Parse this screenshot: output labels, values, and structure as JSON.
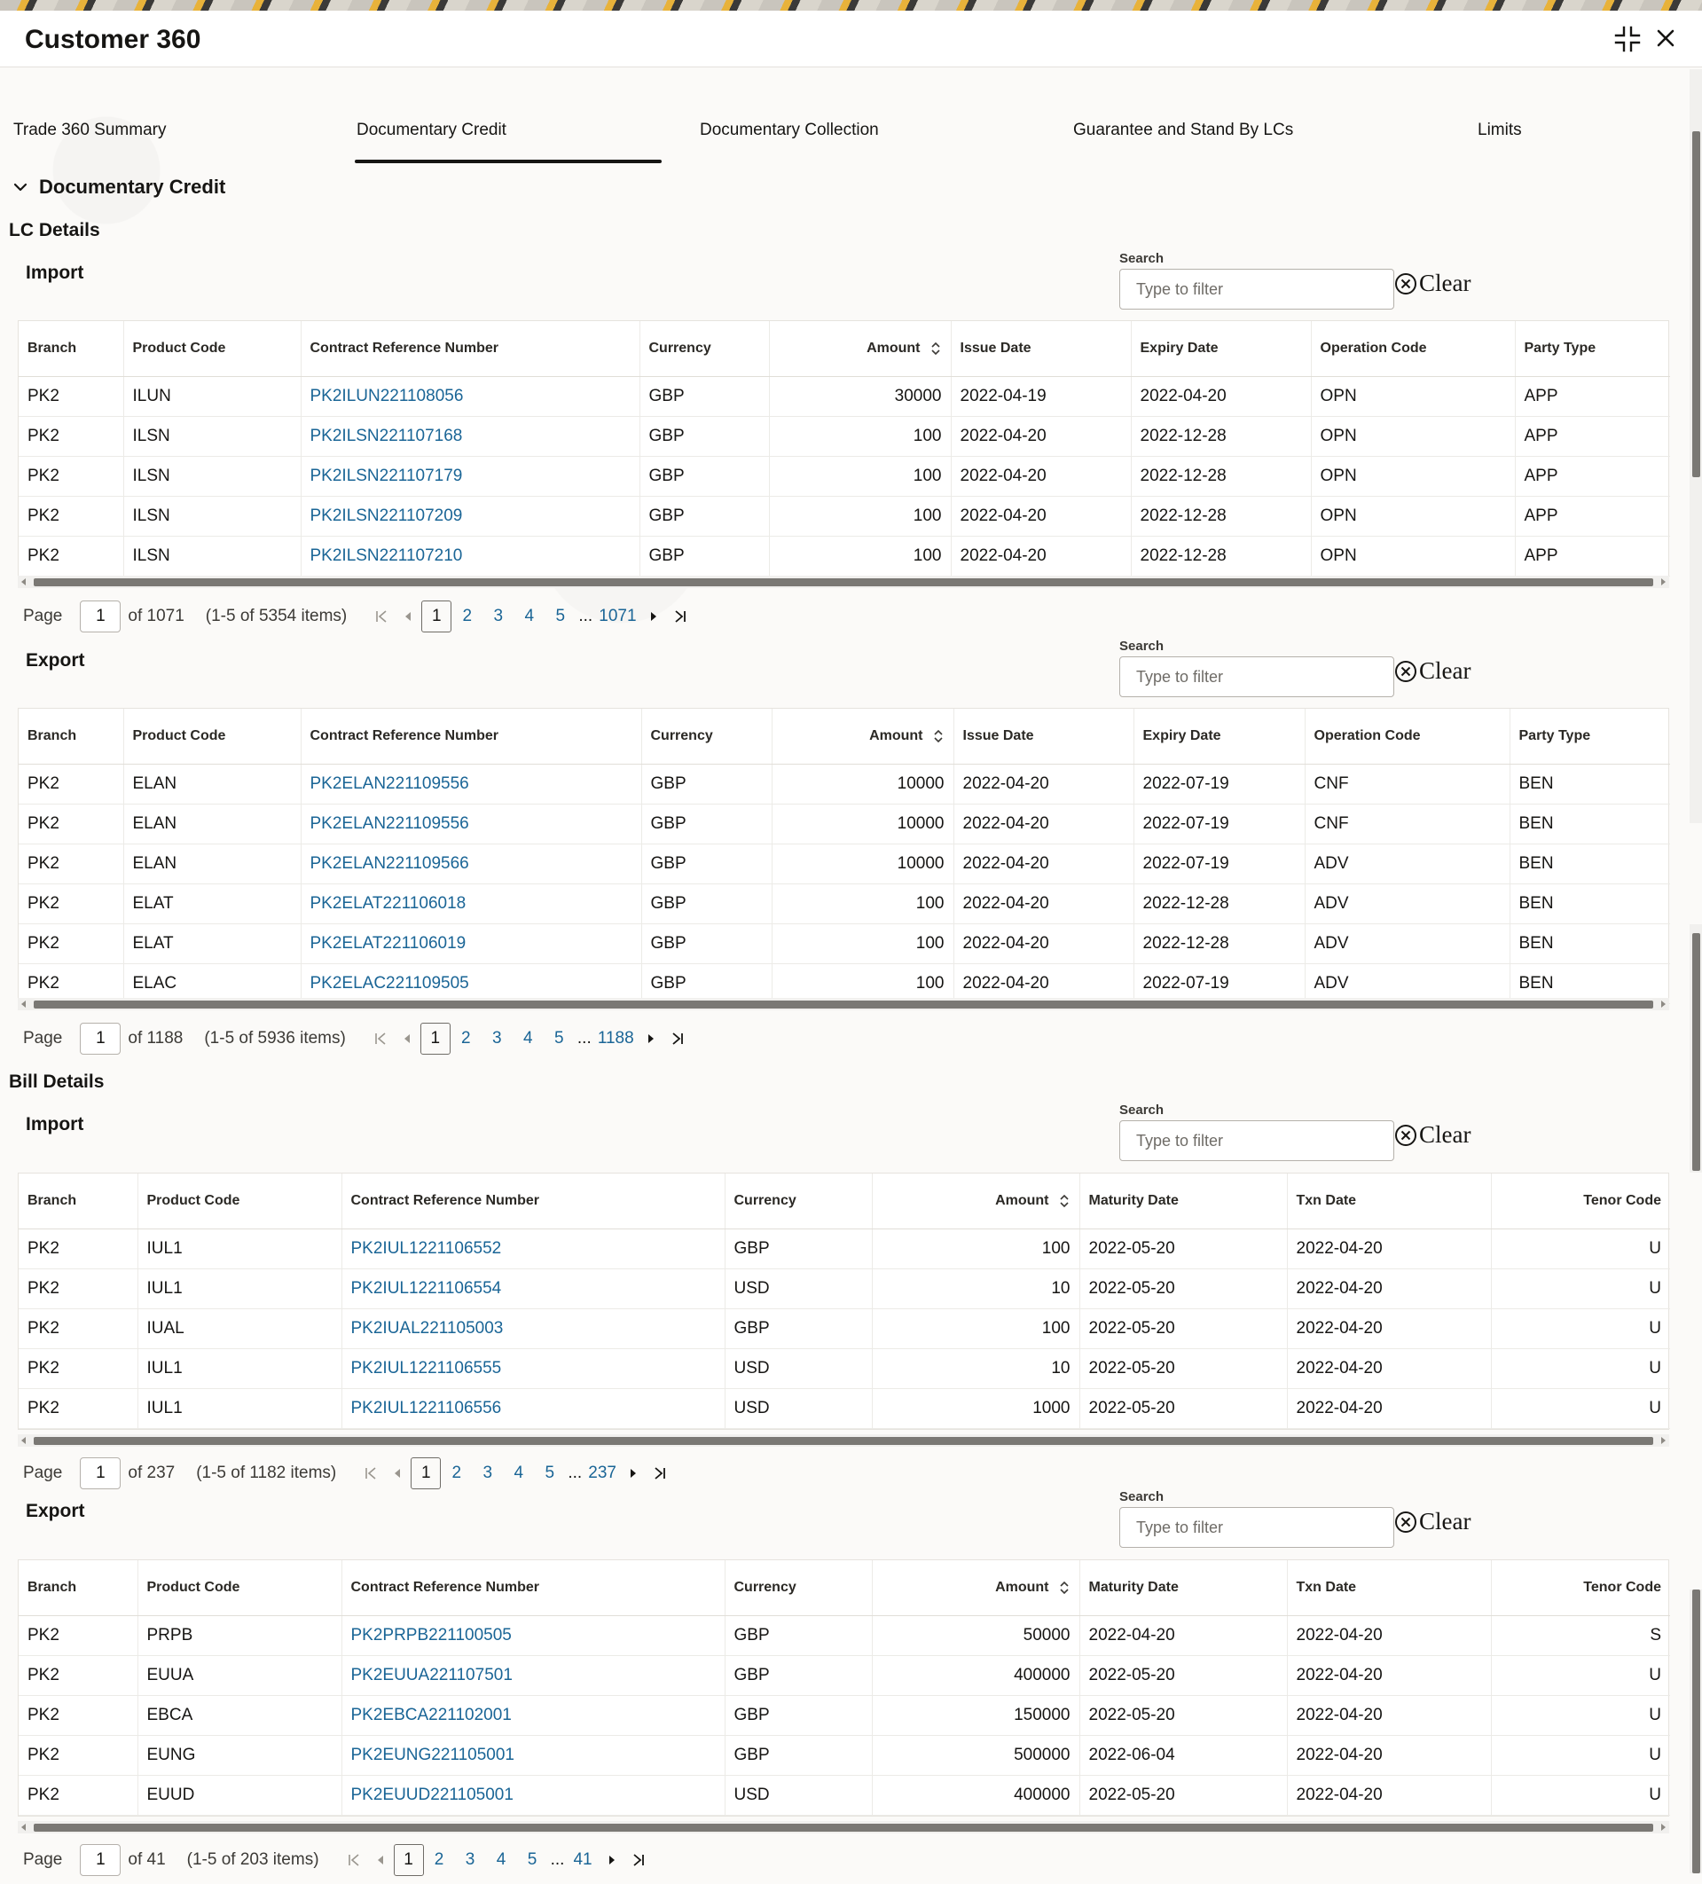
{
  "window": {
    "title": "Customer 360"
  },
  "tabs": [
    {
      "label": "Trade 360 Summary"
    },
    {
      "label": "Documentary Credit"
    },
    {
      "label": "Documentary Collection"
    },
    {
      "label": "Guarantee and Stand By LCs"
    },
    {
      "label": "Limits"
    }
  ],
  "active_tab": "Documentary Credit",
  "section": {
    "title": "Documentary Credit"
  },
  "lc_details": {
    "title": "LC Details"
  },
  "bill_details": {
    "title": "Bill Details"
  },
  "search": {
    "label": "Search",
    "placeholder": "Type to filter",
    "clear_label": "Clear"
  },
  "pager_labels": {
    "page": "Page",
    "ellipsis": "..."
  },
  "lc_import": {
    "title": "Import",
    "columns": [
      "Branch",
      "Product Code",
      "Contract Reference Number",
      "Currency",
      "Amount",
      "Issue Date",
      "Expiry Date",
      "Operation Code",
      "Party Type"
    ],
    "rows": [
      [
        "PK2",
        "ILUN",
        "PK2ILUN221108056",
        "GBP",
        "30000",
        "2022-04-19",
        "2022-04-20",
        "OPN",
        "APP"
      ],
      [
        "PK2",
        "ILSN",
        "PK2ILSN221107168",
        "GBP",
        "100",
        "2022-04-20",
        "2022-12-28",
        "OPN",
        "APP"
      ],
      [
        "PK2",
        "ILSN",
        "PK2ILSN221107179",
        "GBP",
        "100",
        "2022-04-20",
        "2022-12-28",
        "OPN",
        "APP"
      ],
      [
        "PK2",
        "ILSN",
        "PK2ILSN221107209",
        "GBP",
        "100",
        "2022-04-20",
        "2022-12-28",
        "OPN",
        "APP"
      ],
      [
        "PK2",
        "ILSN",
        "PK2ILSN221107210",
        "GBP",
        "100",
        "2022-04-20",
        "2022-12-28",
        "OPN",
        "APP"
      ]
    ],
    "pager": {
      "current": "1",
      "of_text": "of 1071",
      "summary": "(1-5 of 5354 items)",
      "pages": [
        "2",
        "3",
        "4",
        "5"
      ],
      "last": "1071"
    }
  },
  "lc_export": {
    "title": "Export",
    "columns": [
      "Branch",
      "Product Code",
      "Contract Reference Number",
      "Currency",
      "Amount",
      "Issue Date",
      "Expiry Date",
      "Operation Code",
      "Party Type"
    ],
    "rows": [
      [
        "PK2",
        "ELAN",
        "PK2ELAN221109556",
        "GBP",
        "10000",
        "2022-04-20",
        "2022-07-19",
        "CNF",
        "BEN"
      ],
      [
        "PK2",
        "ELAN",
        "PK2ELAN221109556",
        "GBP",
        "10000",
        "2022-04-20",
        "2022-07-19",
        "CNF",
        "BEN"
      ],
      [
        "PK2",
        "ELAN",
        "PK2ELAN221109566",
        "GBP",
        "10000",
        "2022-04-20",
        "2022-07-19",
        "ADV",
        "BEN"
      ],
      [
        "PK2",
        "ELAT",
        "PK2ELAT221106018",
        "GBP",
        "100",
        "2022-04-20",
        "2022-12-28",
        "ADV",
        "BEN"
      ],
      [
        "PK2",
        "ELAT",
        "PK2ELAT221106019",
        "GBP",
        "100",
        "2022-04-20",
        "2022-12-28",
        "ADV",
        "BEN"
      ],
      [
        "PK2",
        "ELAC",
        "PK2ELAC221109505",
        "GBP",
        "100",
        "2022-04-20",
        "2022-07-19",
        "ADV",
        "BEN"
      ]
    ],
    "pager": {
      "current": "1",
      "of_text": "of 1188",
      "summary": "(1-5 of 5936 items)",
      "pages": [
        "2",
        "3",
        "4",
        "5"
      ],
      "last": "1188"
    }
  },
  "bill_import": {
    "title": "Import",
    "columns": [
      "Branch",
      "Product Code",
      "Contract Reference Number",
      "Currency",
      "Amount",
      "Maturity Date",
      "Txn Date",
      "Tenor Code"
    ],
    "rows": [
      [
        "PK2",
        "IUL1",
        "PK2IUL1221106552",
        "GBP",
        "100",
        "2022-05-20",
        "2022-04-20",
        "U"
      ],
      [
        "PK2",
        "IUL1",
        "PK2IUL1221106554",
        "USD",
        "10",
        "2022-05-20",
        "2022-04-20",
        "U"
      ],
      [
        "PK2",
        "IUAL",
        "PK2IUAL221105003",
        "GBP",
        "100",
        "2022-05-20",
        "2022-04-20",
        "U"
      ],
      [
        "PK2",
        "IUL1",
        "PK2IUL1221106555",
        "USD",
        "10",
        "2022-05-20",
        "2022-04-20",
        "U"
      ],
      [
        "PK2",
        "IUL1",
        "PK2IUL1221106556",
        "USD",
        "1000",
        "2022-05-20",
        "2022-04-20",
        "U"
      ]
    ],
    "pager": {
      "current": "1",
      "of_text": "of 237",
      "summary": "(1-5 of 1182 items)",
      "pages": [
        "2",
        "3",
        "4",
        "5"
      ],
      "last": "237"
    }
  },
  "bill_export": {
    "title": "Export",
    "columns": [
      "Branch",
      "Product Code",
      "Contract Reference Number",
      "Currency",
      "Amount",
      "Maturity Date",
      "Txn Date",
      "Tenor Code"
    ],
    "rows": [
      [
        "PK2",
        "PRPB",
        "PK2PRPB221100505",
        "GBP",
        "50000",
        "2022-04-20",
        "2022-04-20",
        "S"
      ],
      [
        "PK2",
        "EUUA",
        "PK2EUUA221107501",
        "GBP",
        "400000",
        "2022-05-20",
        "2022-04-20",
        "U"
      ],
      [
        "PK2",
        "EBCA",
        "PK2EBCA221102001",
        "GBP",
        "150000",
        "2022-05-20",
        "2022-04-20",
        "U"
      ],
      [
        "PK2",
        "EUNG",
        "PK2EUNG221105001",
        "GBP",
        "500000",
        "2022-06-04",
        "2022-04-20",
        "U"
      ],
      [
        "PK2",
        "EUUD",
        "PK2EUUD221105001",
        "USD",
        "400000",
        "2022-05-20",
        "2022-04-20",
        "U"
      ]
    ],
    "pager": {
      "current": "1",
      "of_text": "of 41",
      "summary": "(1-5 of 203 items)",
      "pages": [
        "2",
        "3",
        "4",
        "5"
      ],
      "last": "41"
    }
  },
  "colors": {
    "link": "#1a6596",
    "text": "#161513",
    "accent_underline": "#161513",
    "background": "#fbfaf8"
  }
}
